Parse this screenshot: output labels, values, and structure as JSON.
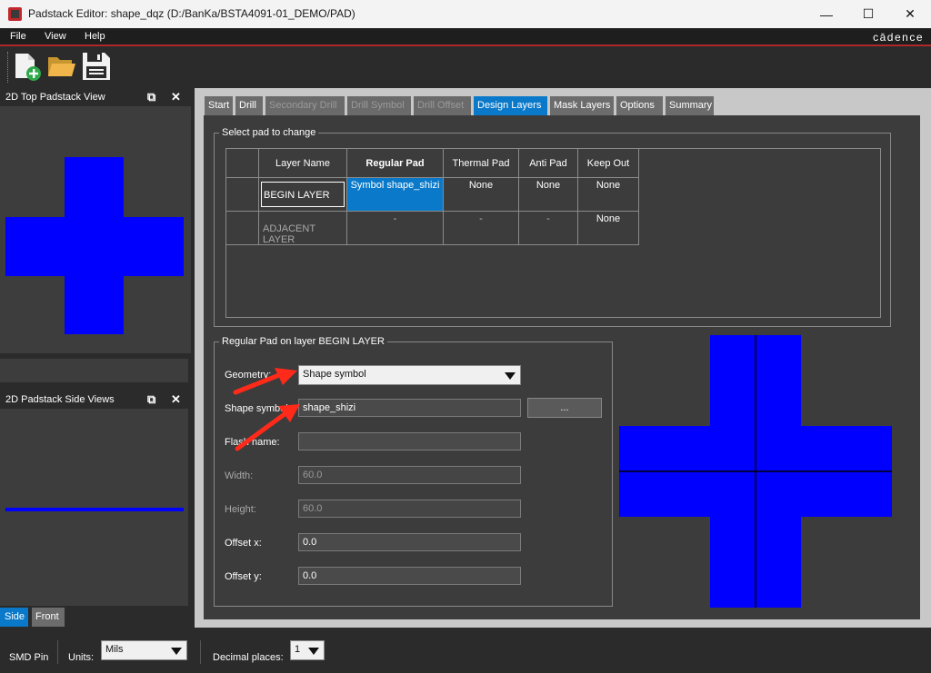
{
  "window": {
    "title": "Padstack Editor: shape_dqz  (D:/BanKa/BSTA4091-01_DEMO/PAD)",
    "minimize": "—",
    "maximize": "☐",
    "close": "✕"
  },
  "menu": {
    "file": "File",
    "view": "View",
    "help": "Help",
    "brand": "cādence"
  },
  "toolbar": {
    "new_icon": "new-file-icon",
    "open_icon": "folder-open-icon",
    "save_icon": "save-icon"
  },
  "top_view": {
    "title": "2D Top Padstack View",
    "float": "⧉",
    "close": "✕"
  },
  "side_view": {
    "title": "2D Padstack Side Views",
    "float": "⧉",
    "close": "✕"
  },
  "side_tabs": [
    {
      "label": "Side"
    },
    {
      "label": "Front"
    }
  ],
  "tabs": [
    {
      "label": "Start",
      "state": "normal"
    },
    {
      "label": "Drill",
      "state": "normal"
    },
    {
      "label": "Secondary Drill",
      "state": "disabled"
    },
    {
      "label": "Drill Symbol",
      "state": "disabled"
    },
    {
      "label": "Drill Offset",
      "state": "disabled"
    },
    {
      "label": "Design Layers",
      "state": "active"
    },
    {
      "label": "Mask Layers",
      "state": "normal"
    },
    {
      "label": "Options",
      "state": "normal"
    },
    {
      "label": "Summary",
      "state": "normal"
    }
  ],
  "pad_select": {
    "title": "Select pad to change",
    "headers": [
      "Layer Name",
      "Regular Pad",
      "Thermal Pad",
      "Anti Pad",
      "Keep Out"
    ],
    "rows": [
      {
        "layer": "BEGIN LAYER",
        "regular": "Symbol shape_shizi",
        "thermal": "None",
        "anti": "None",
        "keepout": "None"
      },
      {
        "layer": "ADJACENT LAYER",
        "regular": "-",
        "thermal": "-",
        "anti": "-",
        "keepout": "None"
      }
    ]
  },
  "regular_pad": {
    "title": "Regular Pad on layer BEGIN LAYER",
    "geometry_label": "Geometry:",
    "geometry_value": "Shape symbol",
    "shape_symbol_label": "Shape symbol:",
    "shape_symbol_value": "shape_shizi",
    "browse_label": "...",
    "flash_label": "Flash name:",
    "flash_value": "",
    "width_label": "Width:",
    "width_value": "60.0",
    "height_label": "Height:",
    "height_value": "60.0",
    "offset_x_label": "Offset x:",
    "offset_x_value": "0.0",
    "offset_y_label": "Offset y:",
    "offset_y_value": "0.0"
  },
  "status": {
    "pin_type": "SMD Pin",
    "units_label": "Units:",
    "units_value": "Mils",
    "decimal_label": "Decimal places:",
    "decimal_value": "1"
  },
  "colors": {
    "pad": "#0000ff",
    "accent": "#0a79c9",
    "arrow": "#ff2a1a",
    "brand_line": "#b0282a"
  }
}
